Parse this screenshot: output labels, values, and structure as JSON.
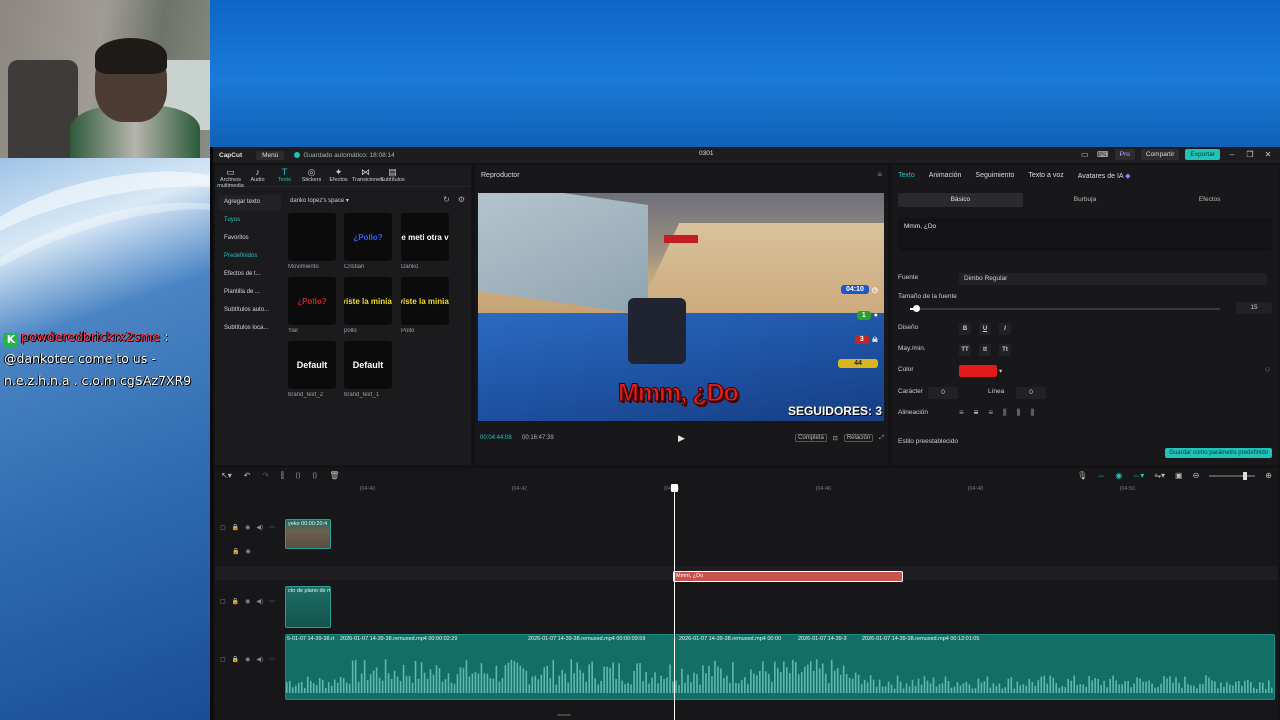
{
  "chat": {
    "badge": "K",
    "username": "powderedbrickrx2sme",
    "separator": " :",
    "message": "@dankotec come to us - n.e.z.h.n.a . c.o.m cgSAz7XR9"
  },
  "titlebar": {
    "app_name": "CapCut",
    "menu_label": "Menú",
    "autosave": "Guardado automático: 18:08:14",
    "project_name": "0301",
    "pro_label": "Pro",
    "share_label": "Compartir",
    "export_label": "Exportar"
  },
  "media": {
    "tabs": [
      {
        "icon": "▭",
        "label": "Archivos multimedia"
      },
      {
        "icon": "♪",
        "label": "Audio"
      },
      {
        "icon": "T",
        "label": "Texto"
      },
      {
        "icon": "◎",
        "label": "Stickers"
      },
      {
        "icon": "✦",
        "label": "Efectos"
      },
      {
        "icon": "⋈",
        "label": "Transiciones"
      },
      {
        "icon": "▤",
        "label": "Subtítulos"
      }
    ],
    "sidebar": [
      "Agregar texto",
      "Tuyos",
      "Favoritos",
      "Predefinidos",
      "Efectos de t...",
      "Plantilla de ...",
      "Subtítulos auto...",
      "Subtítulos loca..."
    ],
    "space_label": "danko lopez's space",
    "items": [
      {
        "preview": "",
        "caption": "Movimiento",
        "color": "#000000"
      },
      {
        "preview": "¿Pollo?",
        "caption": "Cristian",
        "color": "#3b5bff"
      },
      {
        "preview": "e meti otra v",
        "caption": "Danko",
        "color": "#ffffff"
      },
      {
        "preview": "¿Pollo?",
        "caption": "Yair",
        "color": "#d2201f"
      },
      {
        "preview": "viste la miniat",
        "caption": "pollo",
        "color": "#f0e020"
      },
      {
        "preview": "viste la miniat",
        "caption": "Pollo",
        "color": "#f0e020"
      },
      {
        "preview": "Default",
        "caption": "brand_text_2",
        "color": "#ffffff"
      },
      {
        "preview": "Default",
        "caption": "brand_text_1",
        "color": "#ffffff"
      }
    ]
  },
  "player": {
    "title": "Reproductor",
    "overlay_text": "Mmm, ¿Do",
    "followers": "SEGUIDORES: 3",
    "hud_time": "04:10",
    "hud_a": "1",
    "hud_b": "3",
    "hud_c": "44",
    "time_current": "00:04:44:08",
    "time_total": "00:16:47:39",
    "complete_label": "Completa",
    "ratio_label": "Relación"
  },
  "props": {
    "tabs": [
      "Texto",
      "Animación",
      "Seguimiento",
      "Texto a voz",
      "Avatares de IA"
    ],
    "subtabs": [
      "Básico",
      "Burbuja",
      "Efectos"
    ],
    "text_value": "Mmm, ¿Do",
    "font_label": "Fuente",
    "font_value": "Dimbo Regular",
    "size_label": "Tamaño de la fuente",
    "size_value": "15",
    "size_fraction": 0.02,
    "design_label": "Diseño",
    "case_label": "May./min.",
    "format_buttons": [
      "B",
      "U",
      "I"
    ],
    "case_buttons": [
      "TT",
      "tt",
      "Tt"
    ],
    "color_label": "Color",
    "color_value": "#e11a1a",
    "char_label": "Carácter",
    "char_value": "0",
    "line_label": "Línea",
    "line_value": "0",
    "align_label": "Alineación",
    "preset_label": "Estilo preestablecido",
    "save_preset": "Guardar como parámetro predefinido"
  },
  "timeline": {
    "ruler": [
      "|04:40",
      "|04:42",
      "|04:44",
      "|04:46",
      "|04:48",
      "|04:50"
    ],
    "clip_video1": "yeko 00:00:20:4",
    "clip_text": "Mmm, ¿Do",
    "clip_video2": "cto de plano de m",
    "audio_labels": [
      "5-01-07 14-39-38.rt",
      "2026-01-07 14-39-38.remuxed.mp4  00:00:02:29",
      "2026-01-07 14-39-38.remuxed.mp4  00:00:09:59",
      "2026-01-07 14-39-38.remuxed.mp4  00:00",
      "2026-01-07 14-39-3",
      "2026-01-07 14-39-38.remuxed.mp4  00:12:01:05"
    ]
  }
}
